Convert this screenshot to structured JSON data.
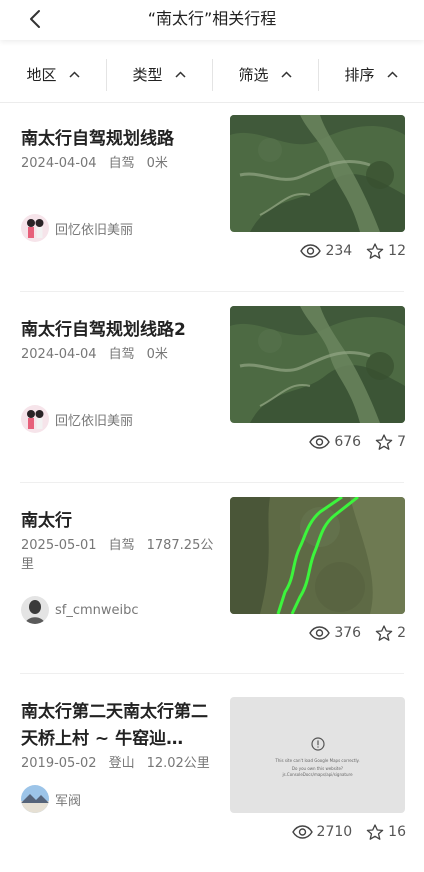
{
  "header": {
    "title": "“南太行”相关行程",
    "back_icon": "chevron-left-icon"
  },
  "filters": [
    {
      "label": "地区",
      "icon": "chevron-up-icon"
    },
    {
      "label": "类型",
      "icon": "chevron-up-icon"
    },
    {
      "label": "筛选",
      "icon": "chevron-up-icon"
    },
    {
      "label": "排序",
      "icon": "chevron-up-icon"
    }
  ],
  "trips": [
    {
      "title": "南太行自驾规划线路",
      "date": "2024-04-04",
      "type": "自驾",
      "distance": "0米",
      "author": "回忆依旧美丽",
      "views": "234",
      "favorites": "12"
    },
    {
      "title": "南太行自驾规划线路2",
      "date": "2024-04-04",
      "type": "自驾",
      "distance": "0米",
      "author": "回忆依旧美丽",
      "views": "676",
      "favorites": "7"
    },
    {
      "title": "南太行",
      "date": "2025-05-01",
      "type": "自驾",
      "distance": "1787.25公里",
      "author": "sf_cmnweibc",
      "views": "376",
      "favorites": "2"
    },
    {
      "title": "南太行第二天南太行第二天桥上村 ~ 牛窑辿…",
      "date": "2019-05-02",
      "type": "登山",
      "distance": "12.02公里",
      "author": "军阀",
      "views": "2710",
      "favorites": "16",
      "map_error": {
        "line1": "This site can't load Google Maps correctly.",
        "line2": "Do you own this website?",
        "line3": "js.ConsoleDocs/maps/api/signature"
      }
    }
  ],
  "icons": {
    "views": "eye-icon",
    "favorites": "star-icon"
  },
  "colors": {
    "text": "#222222",
    "secondary": "#777777",
    "route": "#3cf53c"
  }
}
